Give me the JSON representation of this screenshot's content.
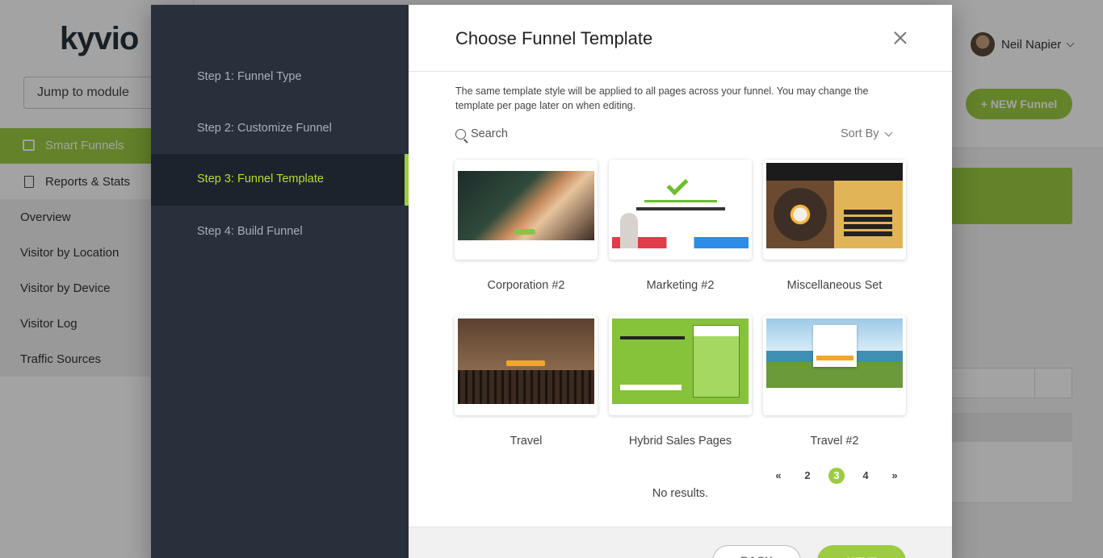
{
  "app": {
    "logo": "kyvio",
    "jump_to_module": "Jump to module",
    "nav_smart_funnels": "Smart Funnels",
    "nav_reports": "Reports & Stats",
    "sub_items": [
      "Overview",
      "Visitor by Location",
      "Visitor by Device",
      "Visitor Log",
      "Traffic Sources"
    ],
    "user_name": "Neil Napier",
    "new_funnel_label": "+ NEW Funnel"
  },
  "steps": [
    {
      "label": "Step 1: Funnel Type",
      "active": false
    },
    {
      "label": "Step 2: Customize Funnel",
      "active": false
    },
    {
      "label": "Step 3: Funnel Template",
      "active": true
    },
    {
      "label": "Step 4: Build Funnel",
      "active": false
    }
  ],
  "modal": {
    "title": "Choose Funnel Template",
    "description": "The same template style will be applied to all pages across your funnel. You may change the template per page later on when editing.",
    "search_label": "Search",
    "sort_label": "Sort By",
    "templates": [
      {
        "name": "Corporation #2"
      },
      {
        "name": "Marketing #2"
      },
      {
        "name": "Miscellaneous Set"
      },
      {
        "name": "Travel"
      },
      {
        "name": "Hybrid Sales Pages"
      },
      {
        "name": "Travel #2"
      }
    ],
    "pagination": {
      "prev": "«",
      "pages": [
        "2",
        "3",
        "4"
      ],
      "current": "3",
      "next": "»"
    },
    "no_results": "No results.",
    "back_label": "BACK",
    "next_label": "NEXT"
  },
  "colors": {
    "accent": "#9ccc42",
    "steps_bg": "#27303b",
    "active_step_text": "#b6dc3a"
  }
}
